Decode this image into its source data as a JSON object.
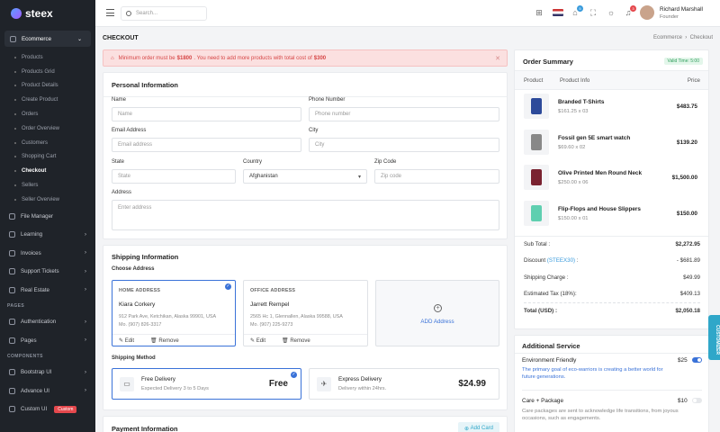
{
  "brand": {
    "name": "steex"
  },
  "sidebar": {
    "ecommerce_label": "Ecommerce",
    "ecommerce_items": [
      "Products",
      "Products Grid",
      "Product Details",
      "Create Product",
      "Orders",
      "Order Overview",
      "Customers",
      "Shopping Cart",
      "Checkout",
      "Sellers",
      "Seller Overview"
    ],
    "active_item": "Checkout",
    "main_items": [
      "File Manager",
      "Learning",
      "Invoices",
      "Support Tickets",
      "Real Estate"
    ],
    "pages_section": "PAGES",
    "pages_items": [
      "Authentication",
      "Pages"
    ],
    "components_section": "COMPONENTS",
    "components_items": [
      "Bootstrap UI",
      "Advance UI",
      "Custom UI"
    ],
    "custom_badge": "Custom"
  },
  "topbar": {
    "search_placeholder": "Search...",
    "cart_count": "5",
    "notif_count": "3",
    "user_name": "Richard Marshall",
    "user_role": "Founder"
  },
  "page": {
    "title": "CHECKOUT",
    "breadcrumb_1": "Ecommerce",
    "breadcrumb_2": "Checkout"
  },
  "alert": {
    "prefix": "Minimum order must be ",
    "min_amount": "$1800",
    "middle": ". You need to add more products with total cost of ",
    "more_amount": "$300"
  },
  "personal": {
    "title": "Personal Information",
    "name_label": "Name",
    "name_placeholder": "Name",
    "phone_label": "Phone Number",
    "phone_placeholder": "Phone number",
    "email_label": "Email Address",
    "email_placeholder": "Email address",
    "city_label": "City",
    "city_placeholder": "City",
    "state_label": "State",
    "state_placeholder": "State",
    "country_label": "Country",
    "country_value": "Afghanistan",
    "zip_label": "Zip Code",
    "zip_placeholder": "Zip code",
    "address_label": "Address",
    "address_placeholder": "Enter address"
  },
  "shipping": {
    "title": "Shipping Information",
    "choose_label": "Choose Address",
    "home": {
      "heading": "HOME ADDRESS",
      "name": "Kiara Corkery",
      "line1": "912 Park Ave, Ketchikan, Alaska 99901, USA",
      "line2": "Mo. (907) 826-3317"
    },
    "office": {
      "heading": "OFFICE ADDRESS",
      "name": "Jarrett Rempel",
      "line1": "2565 Hc 1, Glennallen, Alaska 99588, USA",
      "line2": "Mo. (907) 225-9273"
    },
    "edit_label": "Edit",
    "remove_label": "Remove",
    "add_address": "ADD Address",
    "method_label": "Shipping Method",
    "free": {
      "title": "Free Delivery",
      "sub": "Expected Delivery 3 to 5 Days",
      "price": "Free"
    },
    "express": {
      "title": "Express Delivery",
      "sub": "Delivery within 24hrs.",
      "price": "$24.99"
    }
  },
  "payment": {
    "title": "Payment Information",
    "add_card": "Add Card"
  },
  "order_summary": {
    "title": "Order Summary",
    "valid_badge": "Valid Time: 5:00",
    "col_product": "Product",
    "col_info": "Product Info",
    "col_price": "Price",
    "items": [
      {
        "name": "Branded T-Shirts",
        "qty": "$161.25 x 03",
        "price": "$483.75",
        "color": "#2d4a9a"
      },
      {
        "name": "Fossil gen 5E smart watch",
        "qty": "$69.60 x 02",
        "price": "$139.20",
        "color": "#888888"
      },
      {
        "name": "Olive Printed Men Round Neck",
        "qty": "$250.00 x 06",
        "price": "$1,500.00",
        "color": "#7a2230"
      },
      {
        "name": "Flip-Flops and House Slippers",
        "qty": "$150.00 x 01",
        "price": "$150.00",
        "color": "#5fcfb0"
      }
    ],
    "subtotal_label": "Sub Total :",
    "subtotal": "$2,272.95",
    "discount_label": "Discount",
    "discount_code": "(STEEX30)",
    "discount_colon": ":",
    "discount": "- $681.89",
    "shipping_label": "Shipping Charge :",
    "shipping": "$49.99",
    "tax_label": "Estimated Tax (18%):",
    "tax": "$409.13",
    "total_label": "Total (USD) :",
    "total": "$2,050.18"
  },
  "additional": {
    "title": "Additional Service",
    "eco": {
      "title": "Environment Friendly",
      "price": "$25",
      "desc": "The primary goal of eco-warriors is creating a better world for future generations.",
      "on": true
    },
    "care": {
      "title": "Care + Package",
      "price": "$10",
      "desc": "Care packages are sent to acknowledge life transitions, from joyous occasions, such as engagements.",
      "on": false
    }
  },
  "customizer_label": "CUSTOMIZER",
  "colors": {
    "accent": "#3a72d8",
    "alert_text": "#d64545",
    "sidebar_bg": "#1f2329",
    "valid_green": "#2f9e5c"
  }
}
